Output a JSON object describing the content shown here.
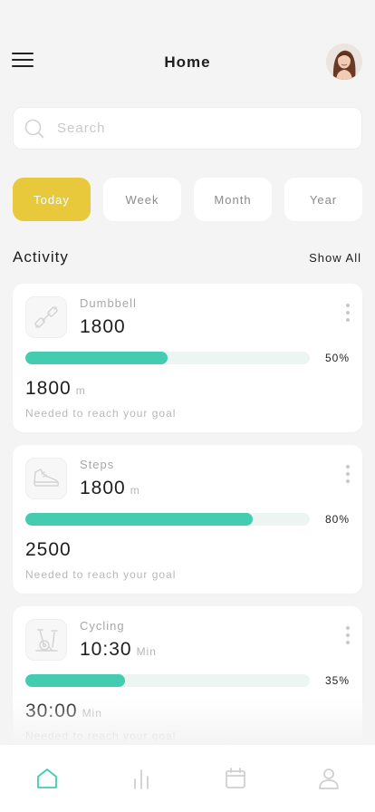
{
  "header": {
    "title": "Home",
    "menu_icon": "hamburger-menu-icon",
    "avatar": "user-avatar-photo"
  },
  "search": {
    "placeholder": "Search",
    "value": "",
    "icon": "search-icon"
  },
  "period_tabs": [
    {
      "label": "Today",
      "active": true
    },
    {
      "label": "Week",
      "active": false
    },
    {
      "label": "Month",
      "active": false
    },
    {
      "label": "Year",
      "active": false
    }
  ],
  "activity": {
    "title": "Activity",
    "show_all": "Show All",
    "cards": [
      {
        "icon": "dumbbell-icon",
        "name": "Dumbbell",
        "value": "1800",
        "value_unit": "",
        "progress": 50,
        "progress_label": "50%",
        "goal_value": "1800",
        "goal_unit": "m",
        "goal_note": "Needed to reach your goal"
      },
      {
        "icon": "sneaker-icon",
        "name": "Steps",
        "value": "1800",
        "value_unit": "m",
        "progress": 80,
        "progress_label": "80%",
        "goal_value": "2500",
        "goal_unit": "",
        "goal_note": "Needed to reach your goal"
      },
      {
        "icon": "exercise-bike-icon",
        "name": "Cycling",
        "value": "10:30",
        "value_unit": "Min",
        "progress": 35,
        "progress_label": "35%",
        "goal_value": "30:00",
        "goal_unit": "Min",
        "goal_note": "Needed to reach your goal"
      }
    ]
  },
  "bottom_nav": [
    {
      "icon": "home-icon",
      "active": true
    },
    {
      "icon": "bar-chart-icon",
      "active": false
    },
    {
      "icon": "calendar-icon",
      "active": false
    },
    {
      "icon": "profile-icon",
      "active": false
    }
  ],
  "colors": {
    "accent_yellow": "#e8c93b",
    "progress_teal": "#44ccb1",
    "progress_track": "#edf5f3",
    "background": "#f4f4f4",
    "nav_active": "#44ccb1",
    "nav_inactive": "#cfcfcf"
  }
}
